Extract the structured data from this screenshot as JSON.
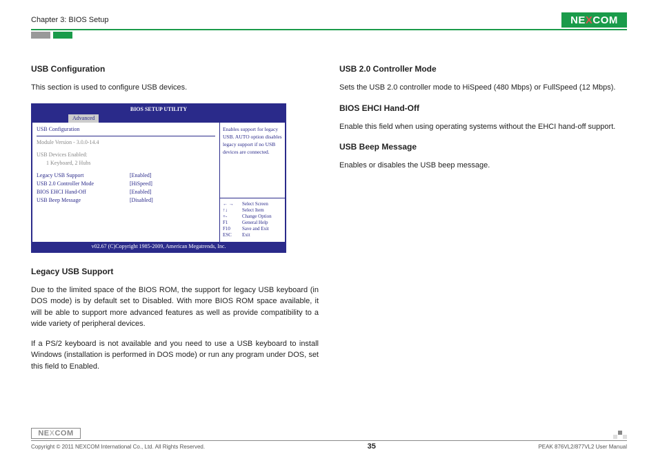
{
  "header": {
    "chapter": "Chapter 3: BIOS Setup",
    "logo_pre": "NE",
    "logo_x": "X",
    "logo_post": "COM"
  },
  "left": {
    "h1": "USB Configuration",
    "p1": "This section is used to configure USB devices.",
    "h2": "Legacy USB Support",
    "p2": "Due to the limited space of the BIOS ROM, the support for legacy USB keyboard (in DOS mode) is by default set to Disabled. With more BIOS ROM space available, it will be able to support more advanced features as well as provide compatibility to a wide variety of peripheral devices.",
    "p3": "If a PS/2 keyboard is not available and you need to use a USB keyboard to install Windows (installation is performed in DOS mode) or run any program under DOS, set this field to Enabled."
  },
  "right": {
    "h1": "USB 2.0 Controller Mode",
    "p1": "Sets the USB 2.0 controller mode to HiSpeed (480 Mbps) or FullSpeed (12 Mbps).",
    "h2": "BIOS EHCI Hand-Off",
    "p2": "Enable this field when using operating systems without the EHCI hand-off support.",
    "h3": "USB Beep Message",
    "p3": "Enables or disables the USB beep message."
  },
  "bios": {
    "title": "BIOS SETUP UTILITY",
    "tab": "Advanced",
    "section": "USB Configuration",
    "module": "Module Version - 3.0.0-14.4",
    "devices_label": "USB Devices Enabled:",
    "devices_value": "1 Keyboard, 2 Hubs",
    "rows": [
      {
        "label": "Legacy USB Support",
        "value": "[Enabled]",
        "hl": true
      },
      {
        "label": "USB 2.0 Controller Mode",
        "value": "[HiSpeed]",
        "hl": false
      },
      {
        "label": "BIOS EHCI Hand-Off",
        "value": "[Enabled]",
        "hl": false
      },
      {
        "label": "USB Beep Message",
        "value": "[Disabled]",
        "hl": false
      }
    ],
    "help": "Enables support for legacy USB. AUTO option disables legacy support if no USB devices are connected.",
    "nav": [
      {
        "key": "← →",
        "action": "Select Screen"
      },
      {
        "key": "↑↓",
        "action": "Select Item"
      },
      {
        "key": "+-",
        "action": "Change Option"
      },
      {
        "key": "F1",
        "action": "General Help"
      },
      {
        "key": "F10",
        "action": "Save and Exit"
      },
      {
        "key": "ESC",
        "action": "Exit"
      }
    ],
    "footer": "v02.67 (C)Copyright 1985-2009, American Megatrends, Inc."
  },
  "footer": {
    "logo_pre": "NE",
    "logo_x": "X",
    "logo_post": "COM",
    "copyright": "Copyright © 2011 NEXCOM International Co., Ltd. All Rights Reserved.",
    "page": "35",
    "manual": "PEAK 876VL2/877VL2 User Manual"
  }
}
